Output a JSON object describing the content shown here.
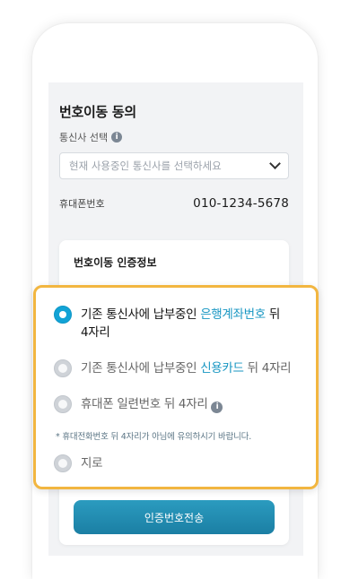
{
  "screen": {
    "title": "번호이동 동의",
    "carrier_label": "통신사 선택",
    "carrier_placeholder": "현재 사용중인 통신사를 선택하세요",
    "phone_label": "휴대폰번호",
    "phone_value": "010-1234-5678",
    "auth_title": "번호이동 인증정보",
    "send_button": "인증번호전송"
  },
  "popup": {
    "options": [
      {
        "prefix": "기존 통신사에 납부중인 ",
        "highlight": "은행계좌번호",
        "suffix": " 뒤 4자리",
        "checked": true
      },
      {
        "prefix": "기존 통신사에 납부중인 ",
        "highlight": "신용카드",
        "suffix": " 뒤 4자리",
        "checked": false
      },
      {
        "prefix": "휴대폰 일련번호 뒤 4자리",
        "highlight": "",
        "suffix": "",
        "checked": false
      },
      {
        "prefix": "지로",
        "highlight": "",
        "suffix": "",
        "checked": false
      }
    ],
    "note": "* 휴대전화번호 뒤 4자리가 아님에 유의하시기 바랍니다."
  },
  "colors": {
    "accent": "#1796c2",
    "popup_border": "#f2b640",
    "button": "#1b7fa4"
  }
}
